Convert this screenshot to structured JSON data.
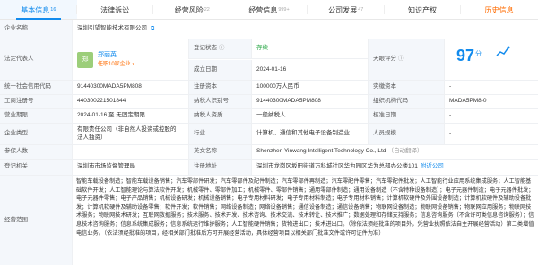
{
  "tabs": [
    {
      "label": "基本信息",
      "count": "16",
      "active": true
    },
    {
      "label": "法律诉讼",
      "count": ""
    },
    {
      "label": "经营风险",
      "count": "22"
    },
    {
      "label": "经营信息",
      "count": "999+"
    },
    {
      "label": "公司发展",
      "count": "47"
    },
    {
      "label": "知识产权",
      "count": ""
    },
    {
      "label": "历史信息",
      "count": "",
      "highlight": true
    }
  ],
  "labels": {
    "company_name": "企业名称",
    "legal_rep": "法定代表人",
    "reg_status": "登记状态",
    "founded": "成立日期",
    "tianyan_score": "天眼评分",
    "credit_code": "统一社会信用代码",
    "reg_capital": "注册资本",
    "paid_capital": "实缴资本",
    "reg_number": "工商注册号",
    "taxpayer_id": "纳税人识别号",
    "org_code": "组织机构代码",
    "term": "营业期限",
    "taxpayer_qual": "纳税人资质",
    "approve_date": "核准日期",
    "company_type": "企业类型",
    "industry": "行业",
    "staff_size": "人员规模",
    "insured": "参保人数",
    "english_name": "英文名称",
    "reg_authority": "登记机关",
    "reg_address": "注册地址",
    "scope": "经营范围"
  },
  "values": {
    "company_name": "深圳引望智能技术有限公司",
    "legal_rep_avatar": "郑",
    "legal_rep_name": "郑丽英",
    "legal_rep_sub": "任职10家企业 ›",
    "reg_status": "存续",
    "founded": "2024-01-16",
    "tianyan_score": "97",
    "tianyan_unit": "分",
    "credit_code": "91440300MADA5PM808",
    "reg_capital": "100000万人民币",
    "paid_capital": "-",
    "reg_number": "440300221501844",
    "taxpayer_id": "91440300MADA5PM808",
    "org_code": "MADA5PM8-0",
    "term": "2024-01-16 至 无固定期限",
    "taxpayer_qual": "一般纳税人",
    "approve_date": "-",
    "company_type_line1": "有限责任公司（非自然人投资或控股的",
    "company_type_line2": "法人独资）",
    "industry": "计算机、通信和其他电子设备制造业",
    "staff_size": "-",
    "insured": "-",
    "english_name": "Shenzhen Yinwang Intelligent Technology Co., Ltd",
    "english_note": "（自动翻译）",
    "reg_authority": "深圳市市场监督管理局",
    "reg_address": "深圳市龙岗区坂田街道万科城社区华为园区华为总部办公楼101",
    "nearby": "附近公司",
    "scope_text": "智能车载设备制造；智能车载设备销售；汽车零部件研发；汽车零部件及配件制造；汽车零部件再制造；汽车零配件零售；汽车零配件批发；人工智能行业应用系统集成服务；人工智能基础软件开发；人工智能理论与算法软件开发；机械零件、零部件加工；机械零件、零部件销售；通用零部件制造；通用设备制造（不含特种设备制造）；电子元器件制造；电子元器件批发；电子元器件零售；电子产品销售；机械设备研发；机械设备销售；电子专用材料研发；电子专用材料制造；电子专用材料销售；计算机软硬件及外围设备制造；计算机软硬件及辅助设备批发；计算机软硬件及辅助设备零售；软件开发；软件销售；网络设备制造；网络设备销售；通信设备制造；通信设备销售；物联网设备制造；物联网设备销售；物联网应用服务；物联网技术服务；物联网技术研发；互联网数据服务；技术服务、技术开发、技术咨询、技术交流、技术转让、技术推广；数据处理和存储支持服务；信息咨询服务（不含许可类信息咨询服务）；信息技术咨询服务；信息系统集成服务；信息系统运行维护服务；人工智能硬件销售；货物进出口；技术进出口。（除依法须经批准的项目外，凭营业执照依法自主开展经营活动）第二类增值电信业务。（依法须经批准的项目，经相关部门批准后方可开展经营活动，具体经营项目以相关部门批准文件或许可证件为准）"
  },
  "colors": {
    "accent": "#128bed",
    "active_green": "#28a745",
    "history_orange": "#ff6b00"
  }
}
